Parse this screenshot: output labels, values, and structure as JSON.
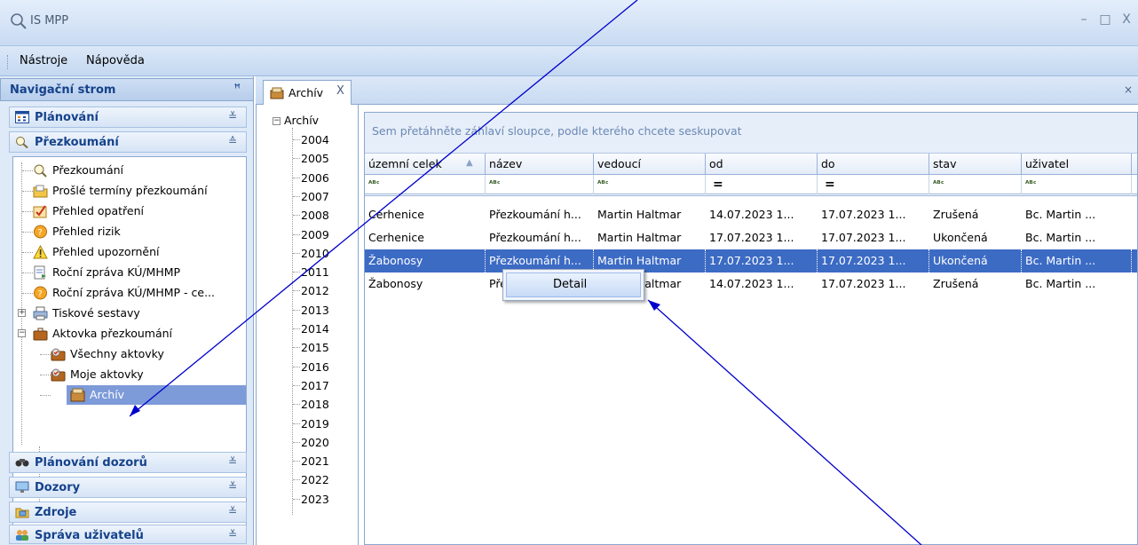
{
  "window": {
    "title": "IS MPP",
    "controls": [
      "–",
      "□",
      "X"
    ]
  },
  "menu": {
    "items": [
      "Nástroje",
      "Nápověda"
    ]
  },
  "nav": {
    "header": "Navigační strom",
    "pin": "ᵖ",
    "groups_top": [
      {
        "label": "Plánování",
        "icon": "calendar-icon",
        "chevron": "≚"
      },
      {
        "label": "Přezkoumání",
        "icon": "review-icon",
        "chevron": "≙"
      }
    ],
    "tree": [
      {
        "label": "Přezkoumání",
        "icon": "review-icon"
      },
      {
        "label": "Prošlé termíny přezkoumání",
        "icon": "folder-icon"
      },
      {
        "label": "Přehled opatření",
        "icon": "checklist-icon"
      },
      {
        "label": "Přehled rizik",
        "icon": "risk-icon"
      },
      {
        "label": "Přehled upozornění",
        "icon": "warning-icon"
      },
      {
        "label": "Roční zpráva KÚ/MHMP",
        "icon": "report-icon"
      },
      {
        "label": "Roční zpráva KÚ/MHMP - ce...",
        "icon": "risk-icon"
      },
      {
        "label": "Tiskové sestavy",
        "icon": "print-icon"
      },
      {
        "label": "Aktovka přezkoumání",
        "icon": "briefcase-icon"
      },
      {
        "label": "Všechny aktovky",
        "icon": "briefcase-check-icon"
      },
      {
        "label": "Moje aktovky",
        "icon": "briefcase-check-icon"
      },
      {
        "label": "Archív",
        "icon": "archive-icon"
      }
    ],
    "groups_bottom": [
      {
        "label": "Plánování dozorů",
        "icon": "binoculars-icon",
        "chevron": "≚"
      },
      {
        "label": "Dozory",
        "icon": "monitor-icon",
        "chevron": "≚"
      },
      {
        "label": "Zdroje",
        "icon": "folder-image-icon",
        "chevron": "≚"
      },
      {
        "label": "Správa uživatelů",
        "icon": "users-icon",
        "chevron": "≚"
      }
    ]
  },
  "tab": {
    "label": "Archív",
    "close": "X",
    "strip_close": "×"
  },
  "archive_tree": {
    "root": "Archív",
    "years": [
      "2004",
      "2005",
      "2006",
      "2007",
      "2008",
      "2009",
      "2010",
      "2011",
      "2012",
      "2013",
      "2014",
      "2015",
      "2016",
      "2017",
      "2018",
      "2019",
      "2020",
      "2021",
      "2022",
      "2023"
    ]
  },
  "grid": {
    "group_hint": "Sem přetáhněte záhlaví sloupce, podle kterého chcete seskupovat",
    "columns": [
      "územní celek",
      "název",
      "vedoucí",
      "od",
      "do",
      "stav",
      "uživatel"
    ],
    "filters": [
      "ᴬᴮᶜ",
      "ᴬᴮᶜ",
      "ᴬᴮᶜ",
      "=",
      "=",
      "ᴬᴮᶜ",
      "ᴬᴮᶜ"
    ],
    "rows": [
      [
        "Cerhenice",
        "Přezkoumání h...",
        "Martin Haltmar",
        "14.07.2023 1...",
        "17.07.2023 1...",
        "Zrušená",
        "Bc. Martin ..."
      ],
      [
        "Cerhenice",
        "Přezkoumání h...",
        "Martin Haltmar",
        "17.07.2023 1...",
        "17.07.2023 1...",
        "Ukončená",
        "Bc. Martin ..."
      ],
      [
        "Žabonosy",
        "Přezkoumání h...",
        "Martin Haltmar",
        "17.07.2023 1...",
        "17.07.2023 1...",
        "Ukončená",
        "Bc. Martin ..."
      ],
      [
        "Žabonosy",
        "Přezkoumání h...",
        "Martin Haltmar",
        "14.07.2023 1...",
        "17.07.2023 1...",
        "Zrušená",
        "Bc. Martin ..."
      ]
    ],
    "selected_row": 2
  },
  "context_menu": {
    "items": [
      "Detail"
    ]
  },
  "colors": {
    "accent": "#15428b",
    "selection": "#3c6bc4",
    "arrow": "#0000cc"
  }
}
